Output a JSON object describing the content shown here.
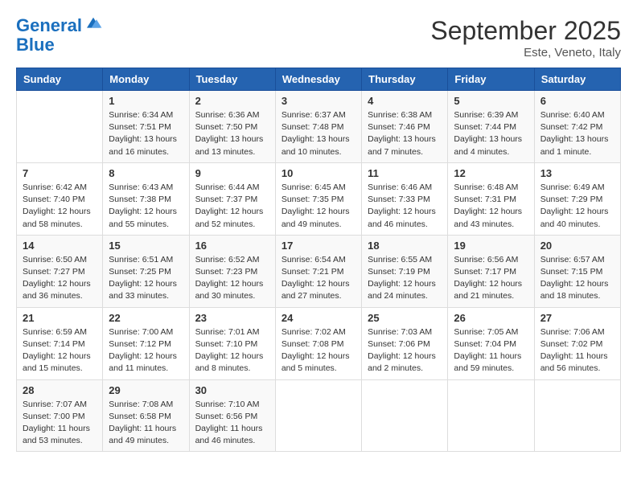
{
  "header": {
    "logo_line1": "General",
    "logo_line2": "Blue",
    "month": "September 2025",
    "location": "Este, Veneto, Italy"
  },
  "weekdays": [
    "Sunday",
    "Monday",
    "Tuesday",
    "Wednesday",
    "Thursday",
    "Friday",
    "Saturday"
  ],
  "weeks": [
    [
      {
        "day": "",
        "info": ""
      },
      {
        "day": "1",
        "info": "Sunrise: 6:34 AM\nSunset: 7:51 PM\nDaylight: 13 hours\nand 16 minutes."
      },
      {
        "day": "2",
        "info": "Sunrise: 6:36 AM\nSunset: 7:50 PM\nDaylight: 13 hours\nand 13 minutes."
      },
      {
        "day": "3",
        "info": "Sunrise: 6:37 AM\nSunset: 7:48 PM\nDaylight: 13 hours\nand 10 minutes."
      },
      {
        "day": "4",
        "info": "Sunrise: 6:38 AM\nSunset: 7:46 PM\nDaylight: 13 hours\nand 7 minutes."
      },
      {
        "day": "5",
        "info": "Sunrise: 6:39 AM\nSunset: 7:44 PM\nDaylight: 13 hours\nand 4 minutes."
      },
      {
        "day": "6",
        "info": "Sunrise: 6:40 AM\nSunset: 7:42 PM\nDaylight: 13 hours\nand 1 minute."
      }
    ],
    [
      {
        "day": "7",
        "info": "Sunrise: 6:42 AM\nSunset: 7:40 PM\nDaylight: 12 hours\nand 58 minutes."
      },
      {
        "day": "8",
        "info": "Sunrise: 6:43 AM\nSunset: 7:38 PM\nDaylight: 12 hours\nand 55 minutes."
      },
      {
        "day": "9",
        "info": "Sunrise: 6:44 AM\nSunset: 7:37 PM\nDaylight: 12 hours\nand 52 minutes."
      },
      {
        "day": "10",
        "info": "Sunrise: 6:45 AM\nSunset: 7:35 PM\nDaylight: 12 hours\nand 49 minutes."
      },
      {
        "day": "11",
        "info": "Sunrise: 6:46 AM\nSunset: 7:33 PM\nDaylight: 12 hours\nand 46 minutes."
      },
      {
        "day": "12",
        "info": "Sunrise: 6:48 AM\nSunset: 7:31 PM\nDaylight: 12 hours\nand 43 minutes."
      },
      {
        "day": "13",
        "info": "Sunrise: 6:49 AM\nSunset: 7:29 PM\nDaylight: 12 hours\nand 40 minutes."
      }
    ],
    [
      {
        "day": "14",
        "info": "Sunrise: 6:50 AM\nSunset: 7:27 PM\nDaylight: 12 hours\nand 36 minutes."
      },
      {
        "day": "15",
        "info": "Sunrise: 6:51 AM\nSunset: 7:25 PM\nDaylight: 12 hours\nand 33 minutes."
      },
      {
        "day": "16",
        "info": "Sunrise: 6:52 AM\nSunset: 7:23 PM\nDaylight: 12 hours\nand 30 minutes."
      },
      {
        "day": "17",
        "info": "Sunrise: 6:54 AM\nSunset: 7:21 PM\nDaylight: 12 hours\nand 27 minutes."
      },
      {
        "day": "18",
        "info": "Sunrise: 6:55 AM\nSunset: 7:19 PM\nDaylight: 12 hours\nand 24 minutes."
      },
      {
        "day": "19",
        "info": "Sunrise: 6:56 AM\nSunset: 7:17 PM\nDaylight: 12 hours\nand 21 minutes."
      },
      {
        "day": "20",
        "info": "Sunrise: 6:57 AM\nSunset: 7:15 PM\nDaylight: 12 hours\nand 18 minutes."
      }
    ],
    [
      {
        "day": "21",
        "info": "Sunrise: 6:59 AM\nSunset: 7:14 PM\nDaylight: 12 hours\nand 15 minutes."
      },
      {
        "day": "22",
        "info": "Sunrise: 7:00 AM\nSunset: 7:12 PM\nDaylight: 12 hours\nand 11 minutes."
      },
      {
        "day": "23",
        "info": "Sunrise: 7:01 AM\nSunset: 7:10 PM\nDaylight: 12 hours\nand 8 minutes."
      },
      {
        "day": "24",
        "info": "Sunrise: 7:02 AM\nSunset: 7:08 PM\nDaylight: 12 hours\nand 5 minutes."
      },
      {
        "day": "25",
        "info": "Sunrise: 7:03 AM\nSunset: 7:06 PM\nDaylight: 12 hours\nand 2 minutes."
      },
      {
        "day": "26",
        "info": "Sunrise: 7:05 AM\nSunset: 7:04 PM\nDaylight: 11 hours\nand 59 minutes."
      },
      {
        "day": "27",
        "info": "Sunrise: 7:06 AM\nSunset: 7:02 PM\nDaylight: 11 hours\nand 56 minutes."
      }
    ],
    [
      {
        "day": "28",
        "info": "Sunrise: 7:07 AM\nSunset: 7:00 PM\nDaylight: 11 hours\nand 53 minutes."
      },
      {
        "day": "29",
        "info": "Sunrise: 7:08 AM\nSunset: 6:58 PM\nDaylight: 11 hours\nand 49 minutes."
      },
      {
        "day": "30",
        "info": "Sunrise: 7:10 AM\nSunset: 6:56 PM\nDaylight: 11 hours\nand 46 minutes."
      },
      {
        "day": "",
        "info": ""
      },
      {
        "day": "",
        "info": ""
      },
      {
        "day": "",
        "info": ""
      },
      {
        "day": "",
        "info": ""
      }
    ]
  ]
}
